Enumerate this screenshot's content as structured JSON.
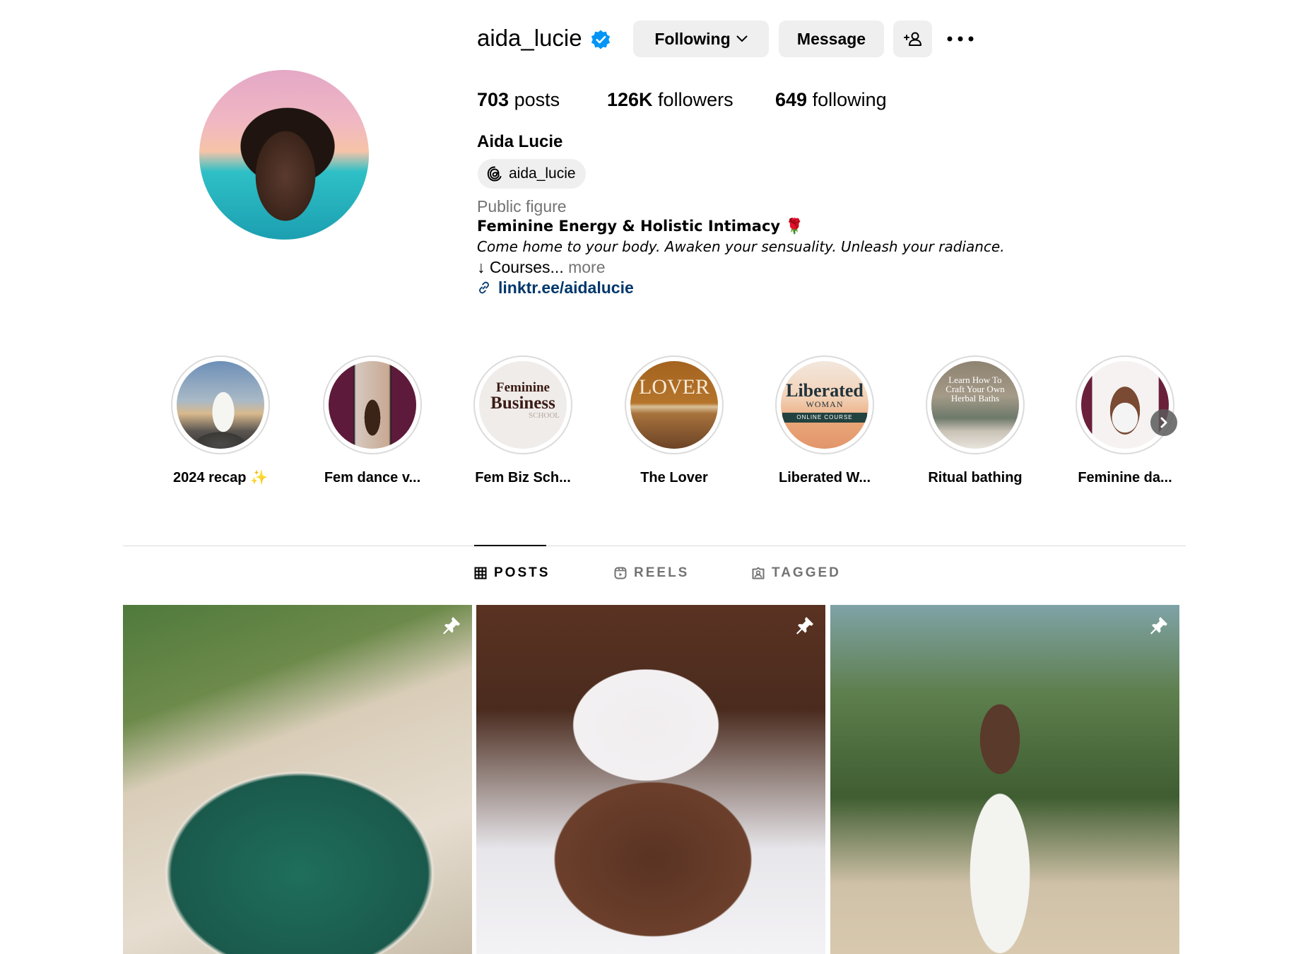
{
  "profile": {
    "username": "aida_lucie",
    "full_name": "Aida Lucie",
    "threads_handle": "aida_lucie",
    "category": "Public figure",
    "bio_line1": "Feminine Energy & Holistic Intimacy 🌹",
    "bio_line2": "Come home to your body. Awaken your sensuality. Unleash your radiance.",
    "bio_line3": "↓ Courses...",
    "more_label": "more",
    "link": "linktr.ee/aidalucie"
  },
  "buttons": {
    "following": "Following",
    "message": "Message"
  },
  "stats": {
    "posts_count": "703",
    "posts_label": " posts",
    "followers_count": "126K",
    "followers_label": " followers",
    "following_count": "649",
    "following_label": " following"
  },
  "highlights": [
    {
      "label": "2024 recap ✨"
    },
    {
      "label": "Fem dance v..."
    },
    {
      "label": "Fem Biz Sch...",
      "cover_line1": "Feminine",
      "cover_line2": "Business",
      "cover_line3": "SCHOOL"
    },
    {
      "label": "The Lover",
      "cover_line1": "LOVER"
    },
    {
      "label": "Liberated W...",
      "cover_line1": "Liberated",
      "cover_line2": "WOMAN",
      "cover_line3": "ONLINE COURSE"
    },
    {
      "label": "Ritual bathing",
      "cover_line1": "Learn How To",
      "cover_line2": "Craft Your Own",
      "cover_line3": "Herbal Baths"
    },
    {
      "label": "Feminine da..."
    }
  ],
  "tabs": {
    "posts": "POSTS",
    "reels": "REELS",
    "tagged": "TAGGED"
  },
  "colors": {
    "verified": "#0095f6",
    "link": "#00376b",
    "secondary_text": "#737373",
    "button_bg": "#efefef"
  }
}
